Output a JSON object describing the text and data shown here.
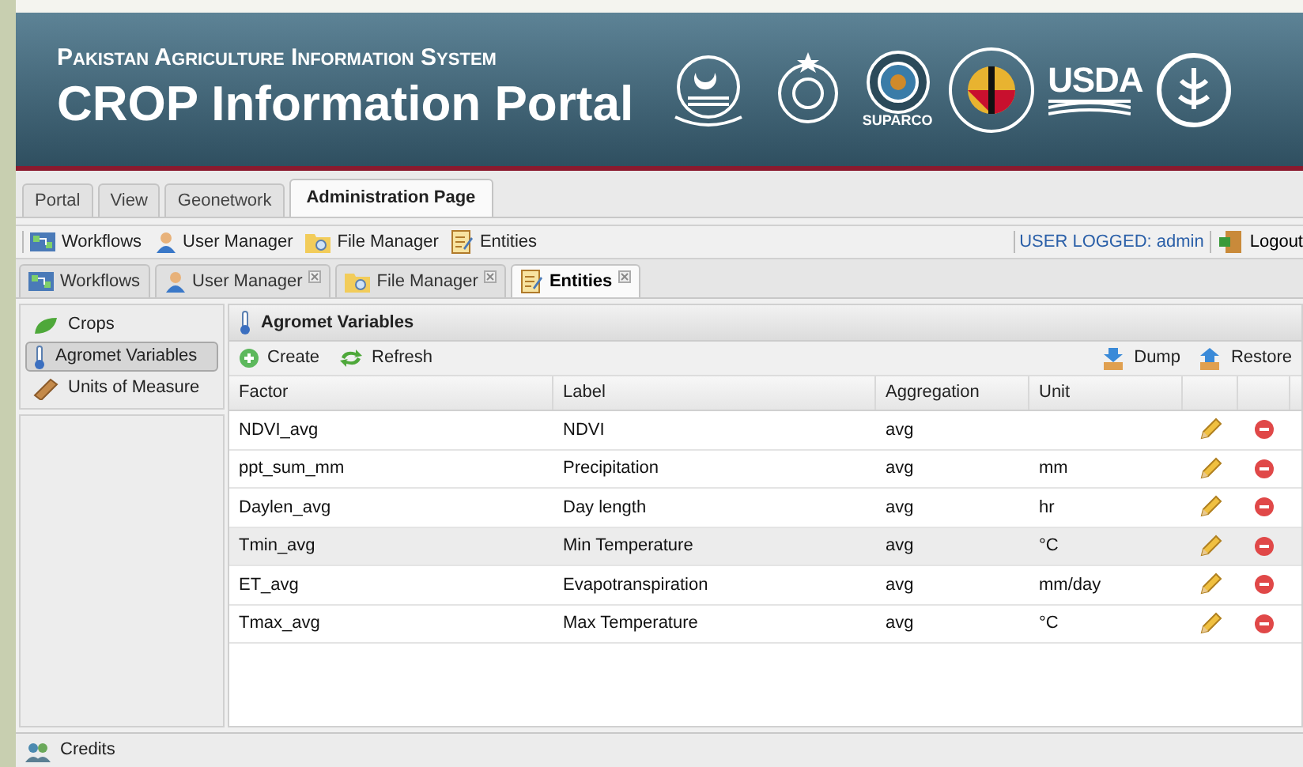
{
  "header": {
    "subtitle": "Pakistan Agriculture Information System",
    "title": "CROP Information Portal",
    "logo_texts": {
      "suparco": "SUPARCO",
      "usda": "USDA"
    }
  },
  "main_tabs": [
    {
      "label": "Portal",
      "selected": false
    },
    {
      "label": "View",
      "selected": false
    },
    {
      "label": "Geonetwork",
      "selected": false
    },
    {
      "label": "Administration Page",
      "selected": true
    }
  ],
  "toolbar": {
    "items": [
      {
        "label": "Workflows"
      },
      {
        "label": "User Manager"
      },
      {
        "label": "File Manager"
      },
      {
        "label": "Entities"
      }
    ],
    "user_logged": "USER LOGGED: admin",
    "logout": "Logout"
  },
  "sub_tabs": [
    {
      "label": "Workflows",
      "closable": false,
      "selected": false
    },
    {
      "label": "User Manager",
      "closable": true,
      "selected": false
    },
    {
      "label": "File Manager",
      "closable": true,
      "selected": false
    },
    {
      "label": "Entities",
      "closable": true,
      "selected": true
    }
  ],
  "sidebar": {
    "items": [
      {
        "label": "Crops",
        "selected": false
      },
      {
        "label": "Agromet Variables",
        "selected": true
      },
      {
        "label": "Units of Measure",
        "selected": false
      }
    ]
  },
  "panel": {
    "title": "Agromet Variables",
    "actions": [
      "Create",
      "Refresh"
    ],
    "right_actions": [
      "Dump",
      "Restore"
    ]
  },
  "table": {
    "columns": [
      "Factor",
      "Label",
      "Aggregation",
      "Unit"
    ],
    "rows": [
      {
        "cells": [
          "NDVI_avg",
          "NDVI",
          "avg",
          ""
        ],
        "selected": false
      },
      {
        "cells": [
          "ppt_sum_mm",
          "Precipitation",
          "avg",
          "mm"
        ],
        "selected": false
      },
      {
        "cells": [
          "Daylen_avg",
          "Day length",
          "avg",
          "hr"
        ],
        "selected": false
      },
      {
        "cells": [
          "Tmin_avg",
          "Min Temperature",
          "avg",
          "°C"
        ],
        "selected": true
      },
      {
        "cells": [
          "ET_avg",
          "Evapotranspiration",
          "avg",
          "mm/day"
        ],
        "selected": false
      },
      {
        "cells": [
          "Tmax_avg",
          "Max Temperature",
          "avg",
          "°C"
        ],
        "selected": false
      }
    ]
  },
  "footer": {
    "label": "Credits"
  }
}
